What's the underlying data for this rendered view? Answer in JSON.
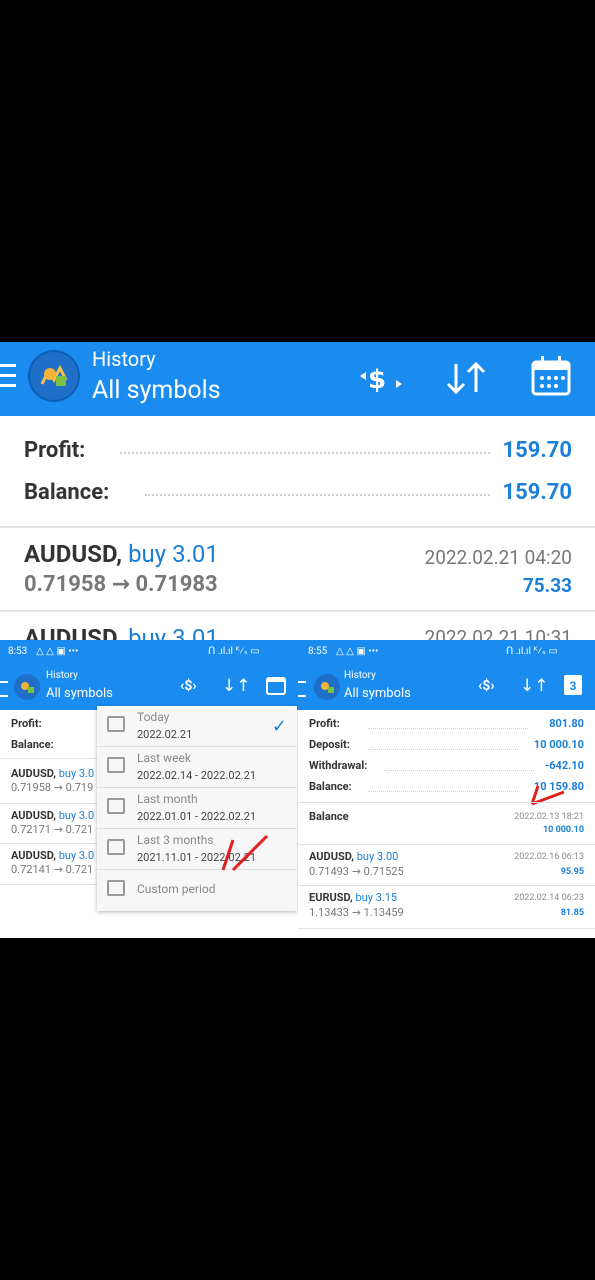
{
  "main": {
    "title": "History",
    "subtitle": "All symbols",
    "profit_label": "Profit:",
    "profit_value": "159.70",
    "balance_label": "Balance:",
    "balance_value": "159.70",
    "deal1": {
      "symbol": "AUDUSD,",
      "side": "buy 3.01",
      "price_open": "0.71958",
      "arrow": "→",
      "price_close": "0.71983",
      "time": "2022.02.21 04:20",
      "profit": "75.33"
    },
    "deal2": {
      "symbol": "AUDUSD,",
      "side": "buy 3.01",
      "time": "2022.02.21 10:31"
    }
  },
  "left": {
    "status_time": "8:53",
    "status_icons": "△ △ ▣ •••",
    "status_right": "ᑎ .ıl.ıl ᴷ⁄ₛ ▭",
    "title": "History",
    "subtitle": "All symbols",
    "profit_label": "Profit:",
    "balance_label": "Balance:",
    "deals": [
      {
        "symbol": "AUDUSD,",
        "side": "buy 3.0",
        "prices": "0.71958 → 0.719"
      },
      {
        "symbol": "AUDUSD,",
        "side": "buy 3.0",
        "prices": "0.72171 → 0.721"
      },
      {
        "symbol": "AUDUSD,",
        "side": "buy 3.0",
        "prices": "0.72141 → 0.721"
      }
    ],
    "menu": [
      {
        "label": "Today",
        "range": "2022.02.21"
      },
      {
        "label": "Last week",
        "range": "2022.02.14 - 2022.02.21"
      },
      {
        "label": "Last month",
        "range": "2022.01.01 - 2022.02.21"
      },
      {
        "label": "Last 3 months",
        "range": "2021.11.01 - 2022.02.21"
      },
      {
        "label": "Custom period",
        "range": ""
      }
    ],
    "check": "✓"
  },
  "right": {
    "status_time": "8:55",
    "status_icons": "△ △ ▣ •••",
    "status_right": "ᑎ .ıl.ıl ᴷ⁄ₛ ▭",
    "title": "History",
    "subtitle": "All symbols",
    "calendar_day": "3",
    "profit_label": "Profit:",
    "profit_value": "801.80",
    "deposit_label": "Deposit:",
    "deposit_value": "10 000.10",
    "withdrawal_label": "Withdrawal:",
    "withdrawal_value": "-642.10",
    "balance_label": "Balance:",
    "balance_value": "10 159.80",
    "balance_entry": {
      "label": "Balance",
      "time": "2022.02.13 18:21",
      "value": "10 000.10"
    },
    "deals": [
      {
        "symbol": "AUDUSD,",
        "side": "buy 3.00",
        "prices": "0.71493 → 0.71525",
        "time": "2022.02.16 06:13",
        "profit": "95.95"
      },
      {
        "symbol": "EURUSD,",
        "side": "buy 3.15",
        "prices": "1.13433 → 1.13459",
        "time": "2022.02.14 06:23",
        "profit": "81.85"
      }
    ]
  },
  "colors": {
    "accent": "#1a8cf0",
    "link": "#1a7fd6",
    "annotation": "#e02020"
  }
}
